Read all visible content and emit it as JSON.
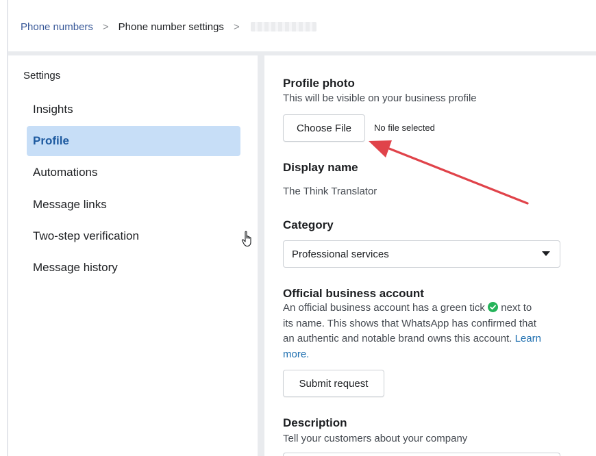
{
  "breadcrumb": {
    "items": [
      "Phone numbers",
      "Phone number settings"
    ],
    "separator": ">"
  },
  "sidebar": {
    "heading": "Settings",
    "items": [
      {
        "label": "Insights"
      },
      {
        "label": "Profile",
        "active": true
      },
      {
        "label": "Automations"
      },
      {
        "label": "Message links"
      },
      {
        "label": "Two-step verification"
      },
      {
        "label": "Message history"
      }
    ]
  },
  "profile_photo": {
    "title": "Profile photo",
    "subtitle": "This will be visible on your business profile",
    "button_label": "Choose File",
    "file_status": "No file selected"
  },
  "display_name": {
    "title": "Display name",
    "value": "The Think Translator"
  },
  "category": {
    "title": "Category",
    "selected": "Professional services"
  },
  "official_account": {
    "title": "Official business account",
    "text_before_tick": "An official business account has a green tick",
    "text_after_tick": "next to its name. This shows that WhatsApp has confirmed that an authentic and notable brand owns this account.",
    "link_label": "Learn more.",
    "button_label": "Submit request",
    "tick_icon": "verified-tick-icon"
  },
  "description": {
    "title": "Description",
    "subtitle": "Tell your customers about your company"
  },
  "colors": {
    "active_item_bg": "#c7def7",
    "active_item_text": "#1e5aa0",
    "link": "#1e6fb0",
    "tick_green": "#25b35a",
    "annotation_arrow": "#e0434a"
  }
}
